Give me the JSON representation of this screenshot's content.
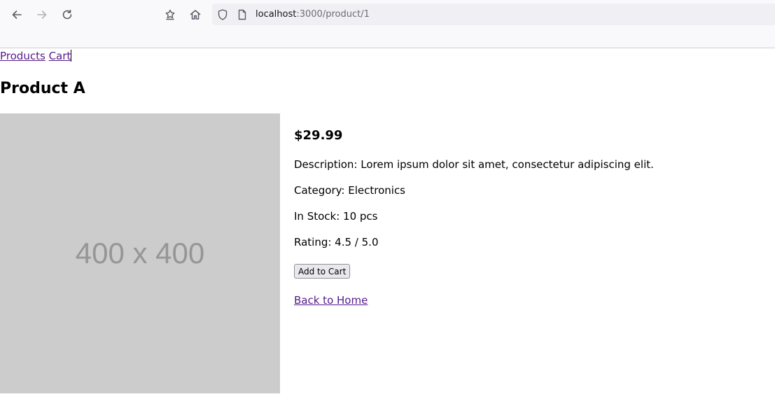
{
  "browser": {
    "url_host": "localhost",
    "url_path": ":3000/product/1"
  },
  "nav": {
    "products_label": "Products",
    "cart_label": "Cart"
  },
  "product": {
    "title": "Product A",
    "image_label": "400 x 400",
    "price": "$29.99",
    "description": "Description: Lorem ipsum dolor sit amet, consectetur adipiscing elit.",
    "category": "Category: Electronics",
    "stock": "In Stock: 10 pcs",
    "rating": "Rating: 4.5 / 5.0",
    "add_to_cart_label": "Add to Cart",
    "back_label": "Back to Home"
  },
  "icons": {
    "back": "arrow-left-icon",
    "forward": "arrow-right-icon",
    "reload": "reload-icon",
    "extensions": "extensions-icon",
    "home": "home-icon",
    "shield": "shield-icon",
    "page": "page-icon"
  },
  "colors": {
    "link": "#551a8b",
    "image_placeholder": "#cccccc",
    "toolbar": "#f9f9fb"
  }
}
